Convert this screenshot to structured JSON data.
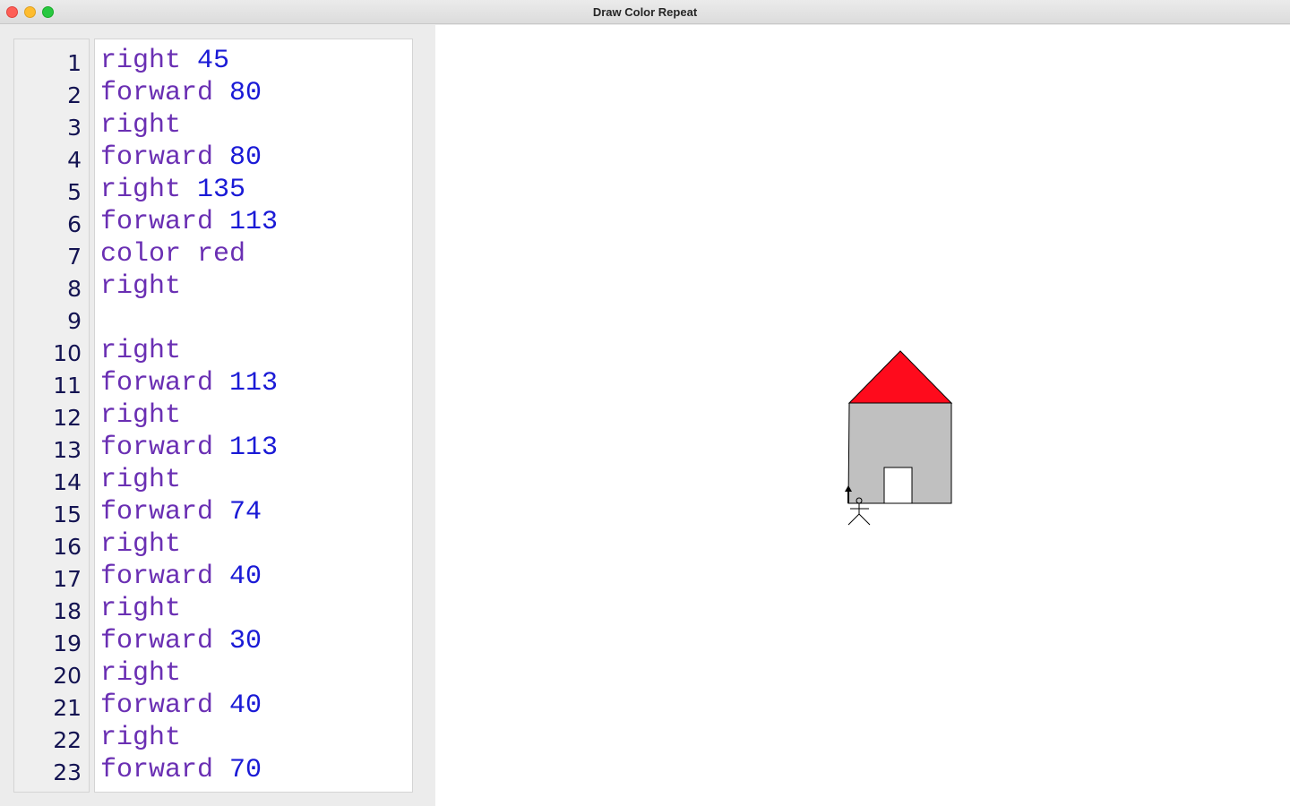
{
  "window": {
    "title": "Draw Color Repeat"
  },
  "colors": {
    "keyword": "#6a2fb3",
    "argument": "#1a1ad6",
    "line_number": "#141452",
    "roof": "#fe0b1c",
    "walls": "#c0c0c0",
    "door": "#ffffff",
    "outline": "#000000"
  },
  "editor": {
    "lines": [
      {
        "n": "1",
        "cmd": "right",
        "arg": "45"
      },
      {
        "n": "2",
        "cmd": "forward",
        "arg": "80"
      },
      {
        "n": "3",
        "cmd": "right",
        "arg": ""
      },
      {
        "n": "4",
        "cmd": "forward",
        "arg": "80"
      },
      {
        "n": "5",
        "cmd": "right",
        "arg": "135"
      },
      {
        "n": "6",
        "cmd": "forward",
        "arg": "113"
      },
      {
        "n": "7",
        "cmd": "color",
        "arg": "red"
      },
      {
        "n": "8",
        "cmd": "right",
        "arg": ""
      },
      {
        "n": "9",
        "cmd": "",
        "arg": ""
      },
      {
        "n": "10",
        "cmd": "right",
        "arg": ""
      },
      {
        "n": "11",
        "cmd": "forward",
        "arg": "113"
      },
      {
        "n": "12",
        "cmd": "right",
        "arg": ""
      },
      {
        "n": "13",
        "cmd": "forward",
        "arg": "113"
      },
      {
        "n": "14",
        "cmd": "right",
        "arg": ""
      },
      {
        "n": "15",
        "cmd": "forward",
        "arg": "74"
      },
      {
        "n": "16",
        "cmd": "right",
        "arg": ""
      },
      {
        "n": "17",
        "cmd": "forward",
        "arg": "40"
      },
      {
        "n": "18",
        "cmd": "right",
        "arg": ""
      },
      {
        "n": "19",
        "cmd": "forward",
        "arg": "30"
      },
      {
        "n": "20",
        "cmd": "right",
        "arg": ""
      },
      {
        "n": "21",
        "cmd": "forward",
        "arg": "40"
      },
      {
        "n": "22",
        "cmd": "right",
        "arg": ""
      },
      {
        "n": "23",
        "cmd": "forward",
        "arg": "70"
      }
    ]
  },
  "drawing": {
    "shapes": [
      "house-roof",
      "house-walls",
      "house-door",
      "turtle-figure",
      "heading-arrow"
    ]
  }
}
